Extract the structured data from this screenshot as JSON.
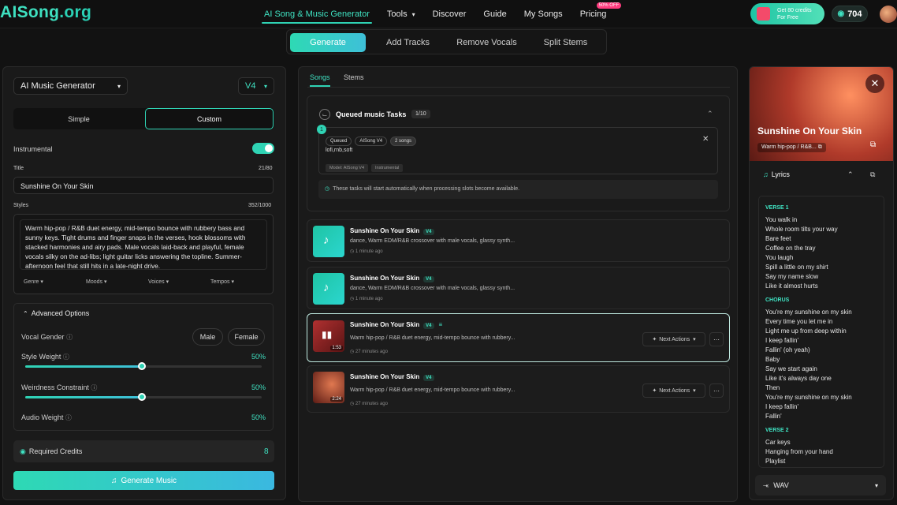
{
  "logo": {
    "brand": "AISong",
    "tld": ".org"
  },
  "nav": {
    "links": [
      "AI Song & Music Generator",
      "Tools",
      "Discover",
      "Guide",
      "My Songs",
      "Pricing"
    ],
    "pricing_badge": "50% OFF",
    "promo_line1": "Get 80 credits",
    "promo_line2": "For Free",
    "credits": "704"
  },
  "subnav": {
    "tabs": [
      "Generate",
      "Add Tracks",
      "Remove Vocals",
      "Split Stems"
    ]
  },
  "left": {
    "model_select": "AI Music Generator",
    "version_select": "V4",
    "mode_simple": "Simple",
    "mode_custom": "Custom",
    "instrumental_label": "Instrumental",
    "title_label": "Title",
    "title_count": "21/80",
    "title_value": "Sunshine On Your Skin",
    "styles_label": "Styles",
    "styles_count": "352/1000",
    "styles_value": "Warm hip-pop / R&B duet energy, mid-tempo bounce with rubbery bass and sunny keys. Tight drums and finger snaps in the verses, hook blossoms with stacked harmonies and airy pads. Male vocals laid-back and playful, female vocals silky on the ad-libs; light guitar licks answering the topline. Summer-afternoon feel that still hits in a late-night drive.",
    "style_chips": [
      "Genre",
      "Moods",
      "Voices",
      "Tempos"
    ],
    "advanced_label": "Advanced Options",
    "vocal_gender_label": "Vocal Gender",
    "male": "Male",
    "female": "Female",
    "style_weight_label": "Style Weight",
    "style_weight_value": "50%",
    "weirdness_label": "Weirdness Constraint",
    "weirdness_value": "50%",
    "audio_weight_label": "Audio Weight",
    "audio_weight_value": "50%",
    "required_credits_label": "Required Credits",
    "required_credits_value": "8",
    "generate_button": "Generate Music"
  },
  "middle": {
    "tabs": [
      "Songs",
      "Stems"
    ],
    "queue_title": "Queued music Tasks",
    "queue_count": "1/10",
    "queue_index": "1",
    "queue_tags": [
      "Queued",
      "AISong V4",
      "2 songs"
    ],
    "queue_style": "lofi,rnb,soft",
    "queue_meta": [
      "Model: AISong V4",
      "Instrumental"
    ],
    "queue_notice": "These tasks will start automatically when processing slots become available.",
    "songs": [
      {
        "title": "Sunshine On Your Skin",
        "version": "V4",
        "desc": "dance, Warm EDM/R&B crossover with male vocals, glassy synth...",
        "time": "1 minute ago",
        "duration": ""
      },
      {
        "title": "Sunshine On Your Skin",
        "version": "V4",
        "desc": "dance, Warm EDM/R&B crossover with male vocals, glassy synth...",
        "time": "1 minute ago",
        "duration": ""
      },
      {
        "title": "Sunshine On Your Skin",
        "version": "V4",
        "desc": "Warm hip-pop / R&B duet energy, mid-tempo bounce with rubbery...",
        "time": "27 minutes ago",
        "duration": "1:53",
        "next": "Next Actions"
      },
      {
        "title": "Sunshine On Your Skin",
        "version": "V4",
        "desc": "Warm hip-pop / R&B duet energy, mid-tempo bounce with rubbery...",
        "time": "27 minutes ago",
        "duration": "2:24",
        "next": "Next Actions"
      }
    ]
  },
  "right": {
    "title": "Sunshine On Your Skin",
    "style_tag": "Warm hip-pop / R&B...",
    "lyrics_label": "Lyrics",
    "verse1_label": "VERSE 1",
    "verse1": [
      "You walk in",
      "Whole room tilts your way",
      "Bare feet",
      "Coffee on the tray",
      "You laugh",
      "Spill a little on my shirt",
      "Say my name slow",
      "Like it almost hurts"
    ],
    "chorus_label": "CHORUS",
    "chorus": [
      "You're my sunshine on my skin",
      "Every time you let me in",
      "Light me up from deep within",
      "I keep fallin'",
      "Fallin' (oh yeah)",
      "Baby",
      "Say we start again",
      "Like it's always day one",
      "Then",
      "You're my sunshine on my skin",
      "I keep fallin'",
      "Fallin'"
    ],
    "verse2_label": "VERSE 2",
    "verse2": [
      "Car keys",
      "Hanging from your hand",
      "Playlist"
    ],
    "format": "WAV"
  }
}
